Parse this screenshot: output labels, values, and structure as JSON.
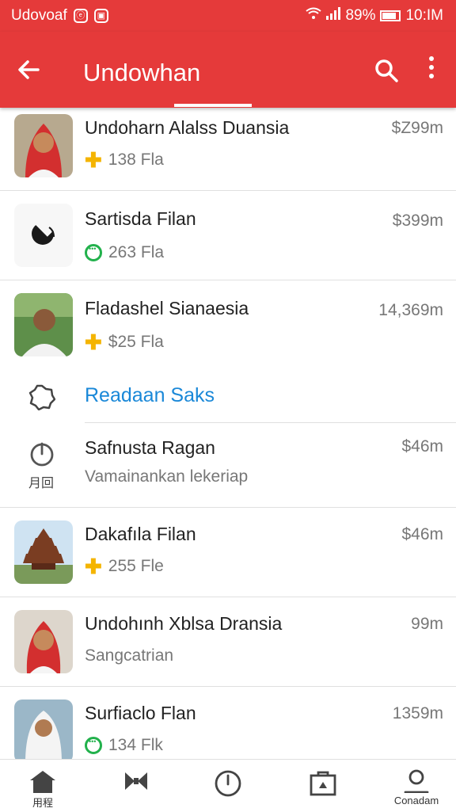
{
  "status_bar": {
    "carrier": "Udovoaf",
    "battery": "89%",
    "time": "10:IM"
  },
  "app_bar": {
    "title": "Undowhan"
  },
  "list": [
    {
      "title": "Undoharn Alalss Duansia",
      "sub": "138 Fla",
      "price": "$Z99m",
      "badge": "plus-icon"
    },
    {
      "title": "Sartisda Filan",
      "sub": "263 Fla",
      "price": "$399m",
      "badge": "chat-icon"
    },
    {
      "title": "Fladashel Sianaesia",
      "sub": "$25 Fla",
      "price": "14,369m",
      "badge": "plus-icon"
    },
    {
      "title": "Safnusta Ragan",
      "sub": "Vamainankan lekeriap",
      "price": "$46m",
      "side_label": "月回"
    },
    {
      "title": "Dakafıla Filan",
      "sub": "255 Fle",
      "price": "$46m",
      "badge": "plus-icon"
    },
    {
      "title": "Undohınh Xblsa Dransia",
      "sub": "Sangcatrian",
      "price": "99m"
    },
    {
      "title": "Surfiaclo Flan",
      "sub": "134 Flk",
      "price": "1359m",
      "badge": "chat-icon"
    }
  ],
  "link_row": {
    "label": "Readaan Saks"
  },
  "bottom_nav": {
    "home_label": "用程",
    "profile_label": "Conadam"
  },
  "colors": {
    "primary": "#e53a3a",
    "link": "#1a88d8",
    "plus": "#f4b400",
    "chat": "#22b14c"
  }
}
